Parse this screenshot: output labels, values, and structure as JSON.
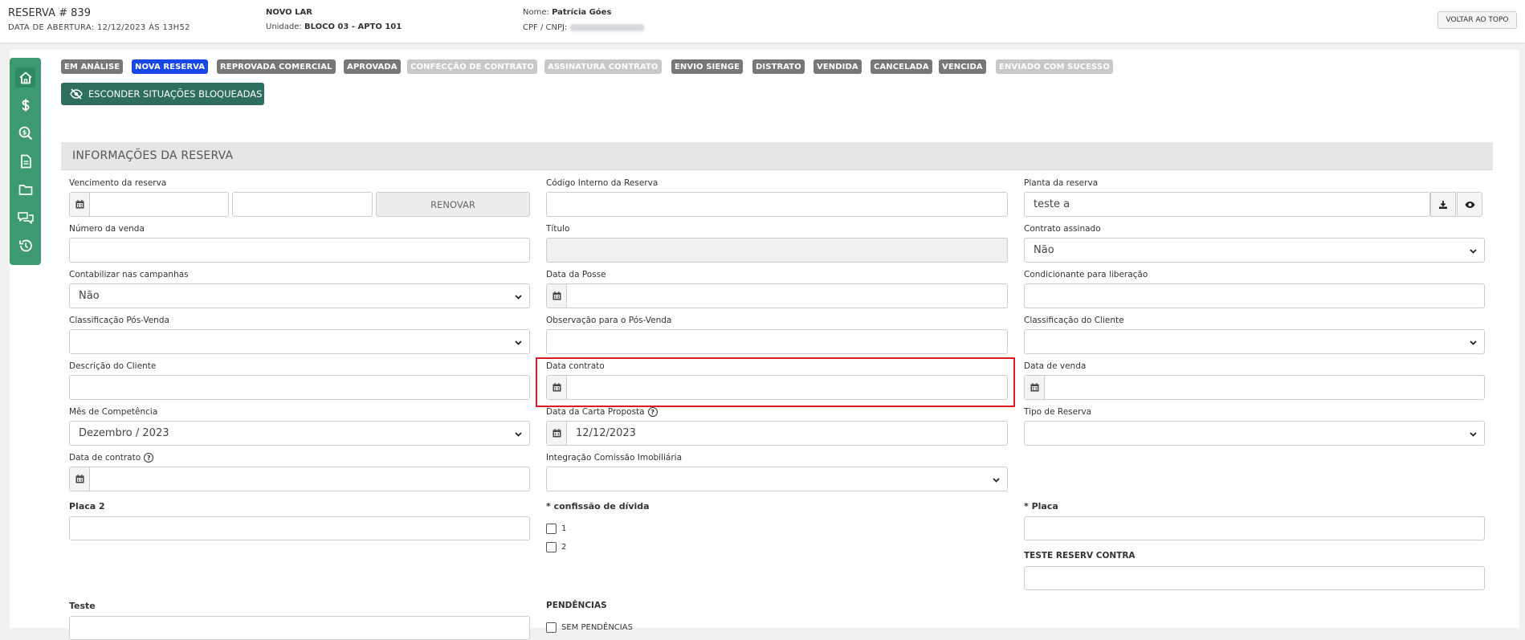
{
  "header": {
    "reserva_title": "RESERVA # 839",
    "abertura": "DATA DE ABERTURA: 12/12/2023 ÀS 13H52",
    "empreendimento": "NOVO LAR",
    "unidade_label": "Unidade:",
    "unidade_value": "BLOCO 03 - APTO 101",
    "nome_label": "Nome:",
    "nome_value": "Patrícia Góes",
    "cpf_label": "CPF / CNPJ:",
    "back_to_top": "VOLTAR AO TOPO"
  },
  "sidebar": {
    "icons": [
      "home-icon",
      "dollar-icon",
      "search-dollar-icon",
      "document-icon",
      "folder-icon",
      "comments-icon",
      "history-icon"
    ]
  },
  "statuses": [
    {
      "label": "EM ANÁLISE",
      "style": "dark"
    },
    {
      "label": "NOVA RESERVA",
      "style": "blue"
    },
    {
      "label": "REPROVADA COMERCIAL",
      "style": "dark"
    },
    {
      "label": "APROVADA",
      "style": "dark"
    },
    {
      "label": "CONFECÇÃO DE CONTRATO",
      "style": "light"
    },
    {
      "label": "ASSINATURA CONTRATO",
      "style": "light"
    },
    {
      "label": "ENVIO SIENGE",
      "style": "dark"
    },
    {
      "label": "DISTRATO",
      "style": "dark"
    },
    {
      "label": "VENDIDA",
      "style": "dark"
    },
    {
      "label": "CANCELADA",
      "style": "dark"
    },
    {
      "label": "VENCIDA",
      "style": "dark"
    },
    {
      "label": "ENVIADO COM SUCESSO",
      "style": "light"
    }
  ],
  "hide_blocked_label": "ESCONDER SITUAÇÕES BLOQUEADAS",
  "section_title": "INFORMAÇÕES DA RESERVA",
  "form": {
    "vencimento_label": "Vencimento da reserva",
    "renovar_label": "RENOVAR",
    "codigo_interno_label": "Código Interno da Reserva",
    "planta_label": "Planta da reserva",
    "planta_value": "teste a",
    "numero_venda_label": "Número da venda",
    "titulo_label": "Título",
    "contrato_assinado_label": "Contrato assinado",
    "contrato_assinado_value": "Não",
    "contabilizar_label": "Contabilizar nas campanhas",
    "contabilizar_value": "Não",
    "data_posse_label": "Data da Posse",
    "condicionante_label": "Condicionante para liberação",
    "classificacao_pos_label": "Classificação Pós-Venda",
    "observacao_pos_label": "Observação para o Pós-Venda",
    "classificacao_cliente_label": "Classificação do Cliente",
    "descricao_cliente_label": "Descrição do Cliente",
    "data_contrato_label": "Data contrato",
    "data_venda_label": "Data de venda",
    "mes_competencia_label": "Mês de Competência",
    "mes_competencia_value": "Dezembro / 2023",
    "data_carta_label": "Data da Carta Proposta",
    "data_carta_value": "12/12/2023",
    "tipo_reserva_label": "Tipo de Reserva",
    "data_de_contrato_label": "Data de contrato",
    "integracao_label": "Integração Comissão Imobiliária",
    "placa2_label": "Placa 2",
    "confissao_label": "* confissão de dívida",
    "confissao_opt1": "1",
    "confissao_opt2": "2",
    "placa_label": "* Placa",
    "teste_reserv_label": "TESTE RESERV CONTRA",
    "teste_label": "Teste",
    "pendencias_label": "PENDÊNCIAS",
    "sem_pendencias_label": "SEM PENDÊNCIAS",
    "help_glyph": "?"
  },
  "colors": {
    "sidebar": "#3d9970",
    "status_blue": "#1747e8",
    "status_dark": "#777777",
    "status_light": "#c8c8c8",
    "highlight": "#e0191e"
  }
}
